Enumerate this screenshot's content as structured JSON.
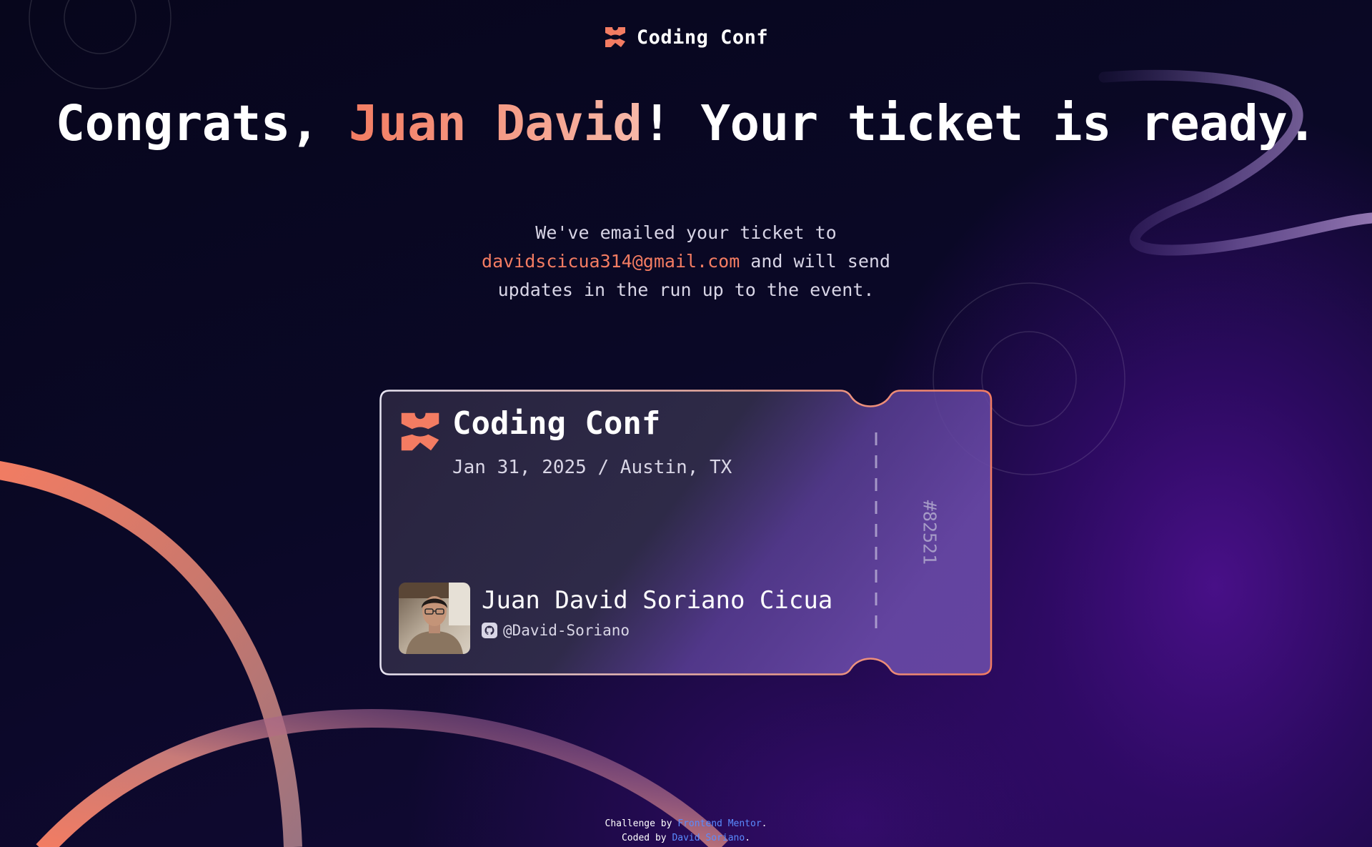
{
  "header": {
    "brand": "Coding Conf",
    "logo_icon": "coding-conf-logo-icon"
  },
  "headline": {
    "prefix": "Congrats, ",
    "name": "Juan David",
    "suffix": "! Your ticket is ready."
  },
  "subtext": {
    "before_email": "We've emailed your ticket to",
    "email": "davidscicua314@gmail.com",
    "after_email": " and will send updates in the run up to the event."
  },
  "ticket": {
    "brand": "Coding Conf",
    "date_location": "Jan 31, 2025 / Austin, TX",
    "attendee_name": "Juan David Soriano Cicua",
    "github_handle": "@David-Soriano",
    "github_icon": "github-icon",
    "ticket_number": "#82521"
  },
  "footer": {
    "challenge_prefix": "Challenge by ",
    "challenge_link": "Frontend Mentor",
    "challenge_suffix": ".",
    "coded_prefix": "Coded by ",
    "coded_link": "David Soriano",
    "coded_suffix": "."
  },
  "colors": {
    "accent_orange": "#f37c62",
    "link_blue": "#5a8bff",
    "background_dark": "#0a0826",
    "background_purple": "#4b108c"
  }
}
